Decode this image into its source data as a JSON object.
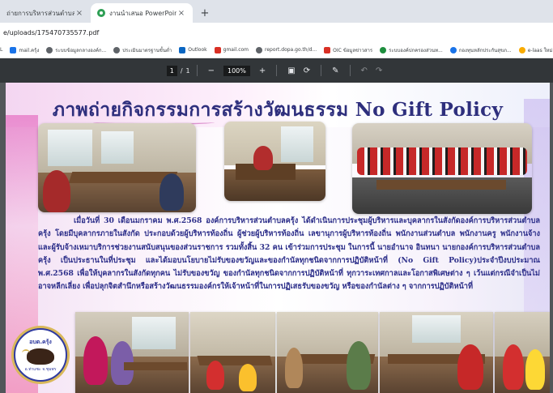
{
  "browser": {
    "tabs": [
      {
        "title": "ถ่ายการบริหารส่วนตำบลครุ้ง",
        "active": false
      },
      {
        "title": "งานนำเสนอ PowerPoint",
        "active": true
      }
    ],
    "new_tab_label": "+",
    "close_label": "×",
    "url": "e/uploads/175470735577.pdf",
    "bookmarks": [
      {
        "label": "L",
        "icon": "folder-icon",
        "color": "#7a7a7a"
      },
      {
        "label": "mail.ครุ้ง",
        "icon": "mail-icon",
        "color": "#1a73e8"
      },
      {
        "label": "ระบบข้อมูลกลางองค์ก...",
        "icon": "globe-icon",
        "color": "#5f6368"
      },
      {
        "label": "ประเมินมาตรฐานขั้นต่ำ",
        "icon": "globe-icon",
        "color": "#5f6368"
      },
      {
        "label": "Outlook",
        "icon": "outlook-icon",
        "color": "#0a66c2"
      },
      {
        "label": "gmail.com",
        "icon": "gmail-icon",
        "color": "#d93025"
      },
      {
        "label": "report.dopa.go.th/d...",
        "icon": "globe-icon",
        "color": "#5f6368"
      },
      {
        "label": "OIC ข้อมูลข่าวสาร",
        "icon": "pdf-icon",
        "color": "#d93025"
      },
      {
        "label": "ระบบองค์ปกครองส่วนท...",
        "icon": "site-icon",
        "color": "#1e8e3e"
      },
      {
        "label": "กองทุนหลักประกันสุขภ...",
        "icon": "site-icon",
        "color": "#1a73e8"
      },
      {
        "label": "e-laas ใหม่",
        "icon": "site-icon",
        "color": "#f9ab00"
      }
    ]
  },
  "pdf_toolbar": {
    "page_current": "1",
    "page_separator": "/",
    "page_total": "1",
    "zoom_out": "−",
    "zoom": "100%",
    "zoom_in": "+"
  },
  "document": {
    "title": "ภาพถ่ายกิจกรรมการสร้างวัฒนธรรม No Gift Policy",
    "body": "เมื่อวันที่ 30 เดือนมกราคม พ.ศ.2568 องค์การบริหารส่วนตำบลครุ้ง ได้ดำเนินการประชุมผู้บริหารและบุคลากรในสังกัดองค์การบริหารส่วนตำบลครุ้ง โดยมีบุคลากรภายในสังกัด ประกอบด้วยผู้บริหารท้องถิ่น ผู้ช่วยผู้บริหารท้องถิ่น เลขานุการผู้บริหารท้องถิ่น พนักงานส่วนตำบล พนักงานครู พนักงานจ้าง และผู้รับจ้างเหมาบริการช่วยงานสนับสนุนของส่วนราชการ รวมทั้งสิ้น 32 คน เข้าร่วมการประชุม ในการนี้ นายอำนาจ อินทนา นายกองค์การบริหารส่วนตำบลครุ้ง เป็นประธานในที่ประชุม และได้มอบนโยบายไม่รับของขวัญและของกำนัลทุกชนิดจากการปฏิบัติหน้าที่ (No Gift Policy)ประจำปีงบประมาณ พ.ศ.2568 เพื่อให้บุคลากรในสังกัดทุกคน ไม่รับของขวัญ ของกำนัลทุกชนิดจากการปฏิบัติหน้าที่ ทุกวาระเทศกาลและโอกาสพิเศษต่าง ๆ เว้นแต่กรณีจำเป็นไม่อาจหลีกเลี่ยง เพื่อปลุกจิตสำนึกหรือสร้างวัฒนธรรมองค์กรให้เจ้าหน้าที่ในการปฏิเสธรับของขวัญ หรือของกำนัลต่าง ๆ จากการปฏิบัติหน้าที่",
    "logo_top": "อบต.ครุ้ง",
    "logo_bottom": "อ.ท่าแซะ จ.ชุมพร"
  }
}
